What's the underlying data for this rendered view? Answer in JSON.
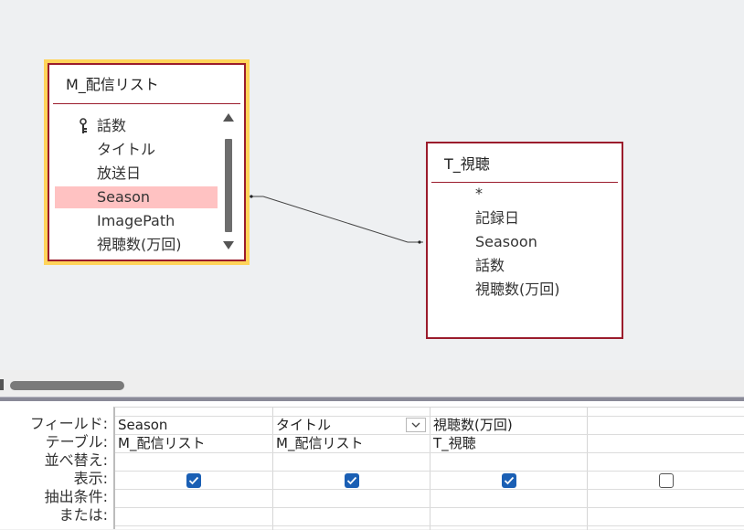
{
  "tables": [
    {
      "title": "M_配信リスト",
      "fields": [
        {
          "label": "話数",
          "primary_key": true
        },
        {
          "label": "タイトル"
        },
        {
          "label": "放送日"
        },
        {
          "label": "Season",
          "highlighted": true
        },
        {
          "label": "ImagePath"
        },
        {
          "label": "視聴数(万回)"
        }
      ]
    },
    {
      "title": "T_視聴",
      "fields": [
        {
          "label": "*"
        },
        {
          "label": "記録日"
        },
        {
          "label": "Seasoon"
        },
        {
          "label": "話数"
        },
        {
          "label": "視聴数(万回)"
        }
      ]
    }
  ],
  "grid": {
    "row_labels": [
      "フィールド:",
      "テーブル:",
      "並べ替え:",
      "表示:",
      "抽出条件:",
      "または:"
    ],
    "columns": [
      {
        "field": "Season",
        "table": "M_配信リスト",
        "show": true
      },
      {
        "field": "タイトル",
        "table": "M_配信リスト",
        "show": true
      },
      {
        "field": "視聴数(万回)",
        "table": "T_視聴",
        "show": true
      },
      {
        "field": "",
        "table": "",
        "show": false
      }
    ]
  },
  "colors": {
    "table_border": "#9b1c2c",
    "selected_outline": "#ffd45a",
    "field_highlight": "#ffc2c2",
    "checkbox_on": "#1a5fb4"
  }
}
